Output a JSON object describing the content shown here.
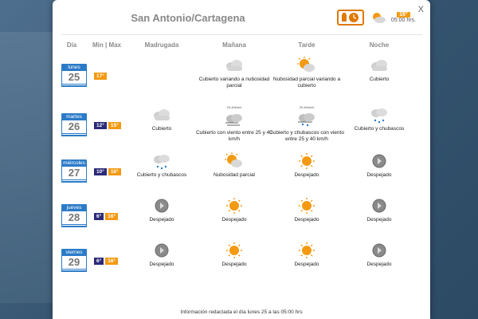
{
  "title": "San Antonio/Cartagena",
  "close_label": "X",
  "now": {
    "temp": "16°",
    "time": "05:00 hrs."
  },
  "columns": {
    "day": "Día",
    "minmax": "Min | Max",
    "madrugada": "Madrugada",
    "manana": "Mañana",
    "tarde": "Tarde",
    "noche": "Noche"
  },
  "days": [
    {
      "name": "lunes",
      "date": "25",
      "min": "",
      "max": "17°",
      "madrugada": {
        "icon": "",
        "label": ""
      },
      "manana": {
        "icon": "cloud",
        "label": "Cubierto variando a nubosidad parcial"
      },
      "tarde": {
        "icon": "sun-cloud",
        "label": "Nubosidad parcial variando a cubierto"
      },
      "noche": {
        "icon": "cloud",
        "label": "Cubierto"
      }
    },
    {
      "name": "martes",
      "date": "26",
      "min": "12°",
      "max": "15°",
      "madrugada": {
        "icon": "cloud",
        "label": "Cubierto"
      },
      "manana": {
        "icon": "cloud-wind",
        "label": "Cubierto con viento entre 25 y 40 km/h",
        "wind": "25-40km/h"
      },
      "tarde": {
        "icon": "cloud-rain-wind",
        "label": "Cubierto y chubascos con viento entre 25 y 40 km/h",
        "wind": "25-40km/h"
      },
      "noche": {
        "icon": "cloud-rain",
        "label": "Cubierto y chubascos"
      }
    },
    {
      "name": "miércoles",
      "date": "27",
      "min": "10°",
      "max": "16°",
      "madrugada": {
        "icon": "cloud-rain",
        "label": "Cubierto y chubascos"
      },
      "manana": {
        "icon": "sun-cloud",
        "label": "Nubosidad parcial"
      },
      "tarde": {
        "icon": "sun",
        "label": "Despejado"
      },
      "noche": {
        "icon": "moon",
        "label": "Despejado"
      }
    },
    {
      "name": "jueves",
      "date": "28",
      "min": "6°",
      "max": "16°",
      "madrugada": {
        "icon": "moon",
        "label": "Despejado"
      },
      "manana": {
        "icon": "sun",
        "label": "Despejado"
      },
      "tarde": {
        "icon": "sun",
        "label": "Despejado"
      },
      "noche": {
        "icon": "moon",
        "label": "Despejado"
      }
    },
    {
      "name": "viernes",
      "date": "29",
      "min": "6°",
      "max": "16°",
      "madrugada": {
        "icon": "moon",
        "label": "Despejado"
      },
      "manana": {
        "icon": "sun",
        "label": "Despejado"
      },
      "tarde": {
        "icon": "sun",
        "label": "Despejado"
      },
      "noche": {
        "icon": "moon",
        "label": "Despejado"
      }
    }
  ],
  "footer": "Información redactada el día lunes 25 a las 05:00 hrs",
  "colors": {
    "accent_blue": "#2b7bc8",
    "min_bg": "#2b2a78",
    "max_bg": "#f39a12",
    "sun": "#f39a12"
  }
}
